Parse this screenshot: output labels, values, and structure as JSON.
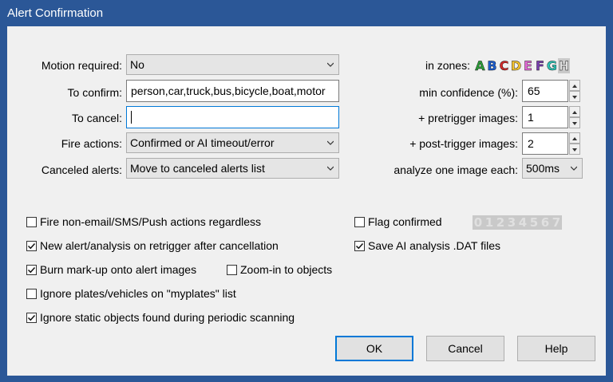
{
  "window": {
    "title": "Alert Confirmation"
  },
  "form": {
    "motion_required": {
      "label": "Motion required:",
      "value": "No"
    },
    "to_confirm": {
      "label": "To confirm:",
      "value": "person,car,truck,bus,bicycle,boat,motor"
    },
    "to_cancel": {
      "label": "To cancel:",
      "value": ""
    },
    "fire_actions": {
      "label": "Fire actions:",
      "value": "Confirmed or AI timeout/error"
    },
    "canceled_alerts": {
      "label": "Canceled alerts:",
      "value": "Move to canceled alerts list"
    }
  },
  "right": {
    "zones_label": "in zones:",
    "zones": [
      {
        "letter": "A",
        "color": "#2e9e3a"
      },
      {
        "letter": "B",
        "color": "#1d5fd1"
      },
      {
        "letter": "C",
        "color": "#d12a2a"
      },
      {
        "letter": "D",
        "color": "#f2c230"
      },
      {
        "letter": "E",
        "color": "#e46bd6"
      },
      {
        "letter": "F",
        "color": "#7a3fb0"
      },
      {
        "letter": "G",
        "color": "#2ec4b6"
      },
      {
        "letter": "H",
        "color": "#c9c9c9"
      }
    ],
    "min_confidence": {
      "label": "min confidence (%):",
      "value": "65"
    },
    "pretrigger": {
      "label": "+ pretrigger images:",
      "value": "1"
    },
    "posttrigger": {
      "label": "+ post-trigger images:",
      "value": "2"
    },
    "analyze_each": {
      "label": "analyze one image each:",
      "value": "500ms"
    }
  },
  "options": {
    "fire_non_email": {
      "label": "Fire non-email/SMS/Push actions regardless",
      "checked": false
    },
    "new_alert": {
      "label": "New alert/analysis on retrigger after cancellation",
      "checked": true
    },
    "burn_markup": {
      "label": "Burn mark-up onto alert images",
      "checked": true
    },
    "zoom_in": {
      "label": "Zoom-in to objects",
      "checked": false
    },
    "ignore_plates": {
      "label": "Ignore plates/vehicles on \"myplates\" list",
      "checked": false
    },
    "ignore_static": {
      "label": "Ignore static objects found during periodic scanning",
      "checked": true
    },
    "flag_confirmed": {
      "label": "Flag confirmed",
      "checked": false
    },
    "save_dat": {
      "label": "Save AI analysis .DAT files",
      "checked": true
    },
    "flag_digits": [
      "0",
      "1",
      "2",
      "3",
      "4",
      "5",
      "6",
      "7"
    ]
  },
  "buttons": {
    "ok": "OK",
    "cancel": "Cancel",
    "help": "Help"
  }
}
